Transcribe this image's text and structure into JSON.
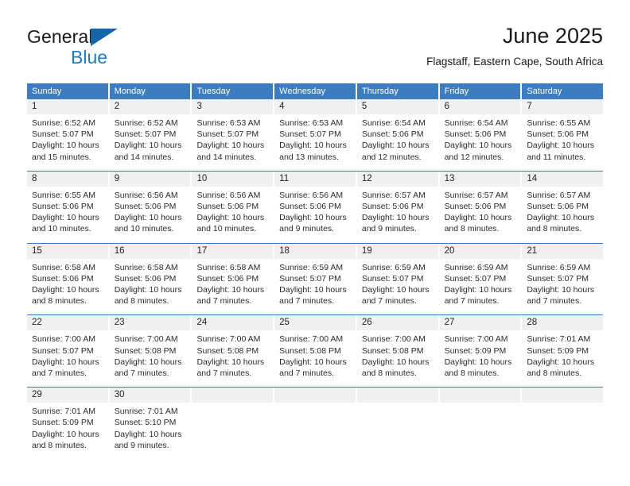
{
  "brand": {
    "name_dark": "General",
    "name_blue": "Blue",
    "triangle_icon": "triangle-icon",
    "accent_dark_blue": "#1565a8",
    "accent_blue": "#1f7bc1"
  },
  "header": {
    "title": "June 2025",
    "subtitle": "Flagstaff, Eastern Cape, South Africa"
  },
  "theme": {
    "header_row_bg": "#3b7dc0",
    "day_number_bg": "#f0f0f0",
    "cell_bg": "#ffffff",
    "text": "#222222"
  },
  "calendar": {
    "weekdays": [
      "Sunday",
      "Monday",
      "Tuesday",
      "Wednesday",
      "Thursday",
      "Friday",
      "Saturday"
    ],
    "weeks": [
      [
        {
          "day": "1",
          "sunrise": "Sunrise: 6:52 AM",
          "sunset": "Sunset: 5:07 PM",
          "daylight_line1": "Daylight: 10 hours",
          "daylight_line2": "and 15 minutes."
        },
        {
          "day": "2",
          "sunrise": "Sunrise: 6:52 AM",
          "sunset": "Sunset: 5:07 PM",
          "daylight_line1": "Daylight: 10 hours",
          "daylight_line2": "and 14 minutes."
        },
        {
          "day": "3",
          "sunrise": "Sunrise: 6:53 AM",
          "sunset": "Sunset: 5:07 PM",
          "daylight_line1": "Daylight: 10 hours",
          "daylight_line2": "and 14 minutes."
        },
        {
          "day": "4",
          "sunrise": "Sunrise: 6:53 AM",
          "sunset": "Sunset: 5:07 PM",
          "daylight_line1": "Daylight: 10 hours",
          "daylight_line2": "and 13 minutes."
        },
        {
          "day": "5",
          "sunrise": "Sunrise: 6:54 AM",
          "sunset": "Sunset: 5:06 PM",
          "daylight_line1": "Daylight: 10 hours",
          "daylight_line2": "and 12 minutes."
        },
        {
          "day": "6",
          "sunrise": "Sunrise: 6:54 AM",
          "sunset": "Sunset: 5:06 PM",
          "daylight_line1": "Daylight: 10 hours",
          "daylight_line2": "and 12 minutes."
        },
        {
          "day": "7",
          "sunrise": "Sunrise: 6:55 AM",
          "sunset": "Sunset: 5:06 PM",
          "daylight_line1": "Daylight: 10 hours",
          "daylight_line2": "and 11 minutes."
        }
      ],
      [
        {
          "day": "8",
          "sunrise": "Sunrise: 6:55 AM",
          "sunset": "Sunset: 5:06 PM",
          "daylight_line1": "Daylight: 10 hours",
          "daylight_line2": "and 10 minutes."
        },
        {
          "day": "9",
          "sunrise": "Sunrise: 6:56 AM",
          "sunset": "Sunset: 5:06 PM",
          "daylight_line1": "Daylight: 10 hours",
          "daylight_line2": "and 10 minutes."
        },
        {
          "day": "10",
          "sunrise": "Sunrise: 6:56 AM",
          "sunset": "Sunset: 5:06 PM",
          "daylight_line1": "Daylight: 10 hours",
          "daylight_line2": "and 10 minutes."
        },
        {
          "day": "11",
          "sunrise": "Sunrise: 6:56 AM",
          "sunset": "Sunset: 5:06 PM",
          "daylight_line1": "Daylight: 10 hours",
          "daylight_line2": "and 9 minutes."
        },
        {
          "day": "12",
          "sunrise": "Sunrise: 6:57 AM",
          "sunset": "Sunset: 5:06 PM",
          "daylight_line1": "Daylight: 10 hours",
          "daylight_line2": "and 9 minutes."
        },
        {
          "day": "13",
          "sunrise": "Sunrise: 6:57 AM",
          "sunset": "Sunset: 5:06 PM",
          "daylight_line1": "Daylight: 10 hours",
          "daylight_line2": "and 8 minutes."
        },
        {
          "day": "14",
          "sunrise": "Sunrise: 6:57 AM",
          "sunset": "Sunset: 5:06 PM",
          "daylight_line1": "Daylight: 10 hours",
          "daylight_line2": "and 8 minutes."
        }
      ],
      [
        {
          "day": "15",
          "sunrise": "Sunrise: 6:58 AM",
          "sunset": "Sunset: 5:06 PM",
          "daylight_line1": "Daylight: 10 hours",
          "daylight_line2": "and 8 minutes."
        },
        {
          "day": "16",
          "sunrise": "Sunrise: 6:58 AM",
          "sunset": "Sunset: 5:06 PM",
          "daylight_line1": "Daylight: 10 hours",
          "daylight_line2": "and 8 minutes."
        },
        {
          "day": "17",
          "sunrise": "Sunrise: 6:58 AM",
          "sunset": "Sunset: 5:06 PM",
          "daylight_line1": "Daylight: 10 hours",
          "daylight_line2": "and 7 minutes."
        },
        {
          "day": "18",
          "sunrise": "Sunrise: 6:59 AM",
          "sunset": "Sunset: 5:07 PM",
          "daylight_line1": "Daylight: 10 hours",
          "daylight_line2": "and 7 minutes."
        },
        {
          "day": "19",
          "sunrise": "Sunrise: 6:59 AM",
          "sunset": "Sunset: 5:07 PM",
          "daylight_line1": "Daylight: 10 hours",
          "daylight_line2": "and 7 minutes."
        },
        {
          "day": "20",
          "sunrise": "Sunrise: 6:59 AM",
          "sunset": "Sunset: 5:07 PM",
          "daylight_line1": "Daylight: 10 hours",
          "daylight_line2": "and 7 minutes."
        },
        {
          "day": "21",
          "sunrise": "Sunrise: 6:59 AM",
          "sunset": "Sunset: 5:07 PM",
          "daylight_line1": "Daylight: 10 hours",
          "daylight_line2": "and 7 minutes."
        }
      ],
      [
        {
          "day": "22",
          "sunrise": "Sunrise: 7:00 AM",
          "sunset": "Sunset: 5:07 PM",
          "daylight_line1": "Daylight: 10 hours",
          "daylight_line2": "and 7 minutes."
        },
        {
          "day": "23",
          "sunrise": "Sunrise: 7:00 AM",
          "sunset": "Sunset: 5:08 PM",
          "daylight_line1": "Daylight: 10 hours",
          "daylight_line2": "and 7 minutes."
        },
        {
          "day": "24",
          "sunrise": "Sunrise: 7:00 AM",
          "sunset": "Sunset: 5:08 PM",
          "daylight_line1": "Daylight: 10 hours",
          "daylight_line2": "and 7 minutes."
        },
        {
          "day": "25",
          "sunrise": "Sunrise: 7:00 AM",
          "sunset": "Sunset: 5:08 PM",
          "daylight_line1": "Daylight: 10 hours",
          "daylight_line2": "and 7 minutes."
        },
        {
          "day": "26",
          "sunrise": "Sunrise: 7:00 AM",
          "sunset": "Sunset: 5:08 PM",
          "daylight_line1": "Daylight: 10 hours",
          "daylight_line2": "and 8 minutes."
        },
        {
          "day": "27",
          "sunrise": "Sunrise: 7:00 AM",
          "sunset": "Sunset: 5:09 PM",
          "daylight_line1": "Daylight: 10 hours",
          "daylight_line2": "and 8 minutes."
        },
        {
          "day": "28",
          "sunrise": "Sunrise: 7:01 AM",
          "sunset": "Sunset: 5:09 PM",
          "daylight_line1": "Daylight: 10 hours",
          "daylight_line2": "and 8 minutes."
        }
      ],
      [
        {
          "day": "29",
          "sunrise": "Sunrise: 7:01 AM",
          "sunset": "Sunset: 5:09 PM",
          "daylight_line1": "Daylight: 10 hours",
          "daylight_line2": "and 8 minutes."
        },
        {
          "day": "30",
          "sunrise": "Sunrise: 7:01 AM",
          "sunset": "Sunset: 5:10 PM",
          "daylight_line1": "Daylight: 10 hours",
          "daylight_line2": "and 9 minutes."
        },
        {
          "day": "",
          "sunrise": "",
          "sunset": "",
          "daylight_line1": "",
          "daylight_line2": ""
        },
        {
          "day": "",
          "sunrise": "",
          "sunset": "",
          "daylight_line1": "",
          "daylight_line2": ""
        },
        {
          "day": "",
          "sunrise": "",
          "sunset": "",
          "daylight_line1": "",
          "daylight_line2": ""
        },
        {
          "day": "",
          "sunrise": "",
          "sunset": "",
          "daylight_line1": "",
          "daylight_line2": ""
        },
        {
          "day": "",
          "sunrise": "",
          "sunset": "",
          "daylight_line1": "",
          "daylight_line2": ""
        }
      ]
    ]
  }
}
